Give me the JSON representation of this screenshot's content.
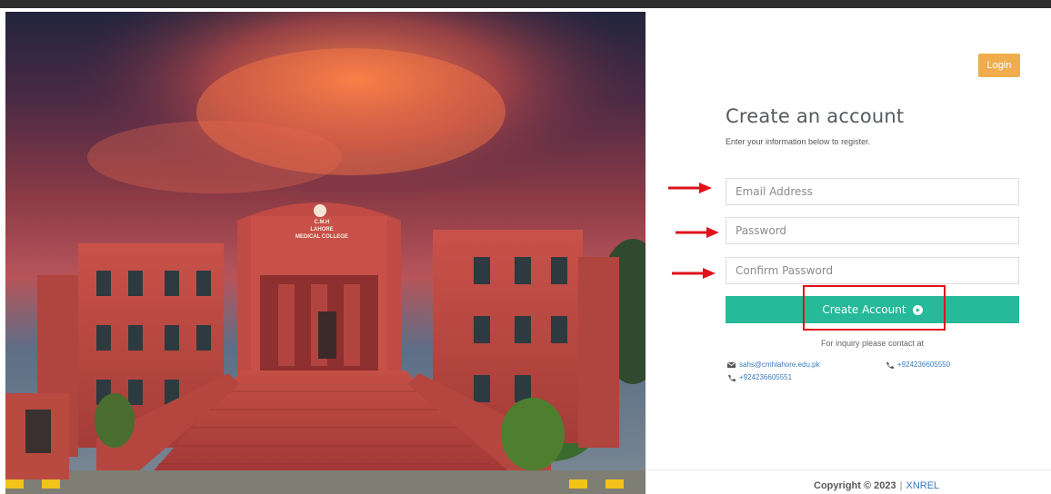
{
  "header": {
    "login_label": "Login"
  },
  "hero": {
    "building_lines": [
      "C.M.H",
      "LAHORE",
      "MEDICAL COLLEGE"
    ]
  },
  "form": {
    "title": "Create an account",
    "subtitle": "Enter your information below to register.",
    "email_placeholder": "Email Address",
    "password_placeholder": "Password",
    "confirm_placeholder": "Confirm Password",
    "submit_label": "Create Account"
  },
  "contact": {
    "inquiry": "For inquiry please contact at",
    "email": "sahs@cmhlahore.edu.pk",
    "phone_1": "+924236605550",
    "phone_2": "+924236605551"
  },
  "footer": {
    "copyright": "Copyright © 2023",
    "separator": "|",
    "brand": "XNREL"
  },
  "colors": {
    "accent_green": "#26b99a",
    "login_orange": "#f0ad4e",
    "annotation_red": "#e0121b",
    "link_blue": "#3a7bbf"
  },
  "icons": [
    "envelope-icon",
    "phone-icon",
    "arrow-right-circle-icon",
    "red-arrow-annotation"
  ]
}
